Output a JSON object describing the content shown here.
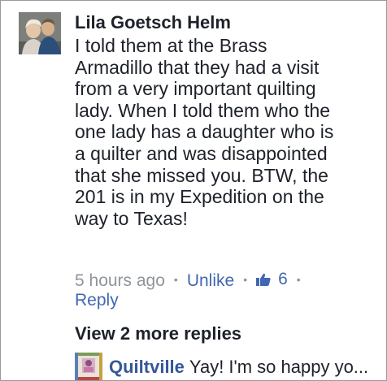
{
  "comment": {
    "author": "Lila Goetsch Helm",
    "lines": [
      "I told them at the Brass",
      "Armadillo that they had a visit",
      "from a very important quilting",
      "lady. When I told them who the",
      "one lady has a daughter who is",
      "a quilter and was disappointed",
      "that she missed you. BTW, the",
      "201 is in my Expedition on the",
      "way to Texas!"
    ],
    "timestamp": "5 hours ago",
    "unlike_label": "Unlike",
    "like_icon": "thumbs-up-icon",
    "like_count": "6",
    "reply_label": "Reply",
    "separator": "•"
  },
  "replies": {
    "more_label": "View 2 more replies",
    "preview": {
      "author": "Quiltville",
      "text": "Yay!  I'm so happy yo..."
    }
  },
  "colors": {
    "text": "#1d2129",
    "muted": "#90949c",
    "link": "#4267b2",
    "reply_author": "#365899"
  }
}
